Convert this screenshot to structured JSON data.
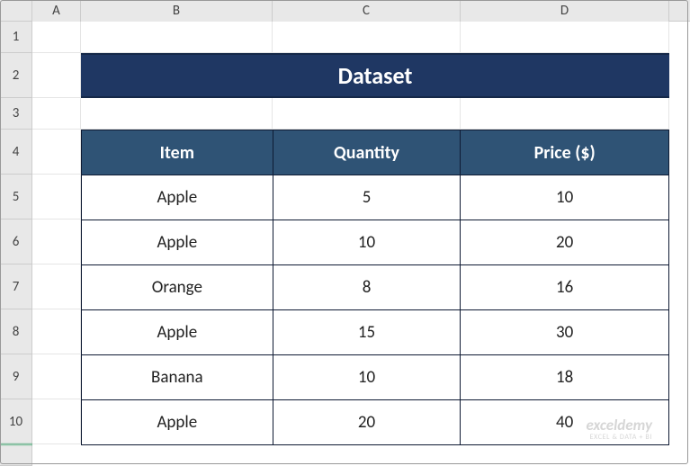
{
  "columns": [
    "A",
    "B",
    "C",
    "D"
  ],
  "rows": [
    "1",
    "2",
    "3",
    "4",
    "5",
    "6",
    "7",
    "8",
    "9",
    "10",
    ""
  ],
  "title": "Dataset",
  "headers": {
    "item": "Item",
    "quantity": "Quantity",
    "price": "Price ($)"
  },
  "data": [
    {
      "item": "Apple",
      "quantity": "5",
      "price": "10"
    },
    {
      "item": "Apple",
      "quantity": "10",
      "price": "20"
    },
    {
      "item": "Orange",
      "quantity": "8",
      "price": "16"
    },
    {
      "item": "Apple",
      "quantity": "15",
      "price": "30"
    },
    {
      "item": "Banana",
      "quantity": "10",
      "price": "18"
    },
    {
      "item": "Apple",
      "quantity": "20",
      "price": "40"
    }
  ],
  "watermark": {
    "brand": "exceldemy",
    "tagline": "EXCEL & DATA + BI"
  }
}
